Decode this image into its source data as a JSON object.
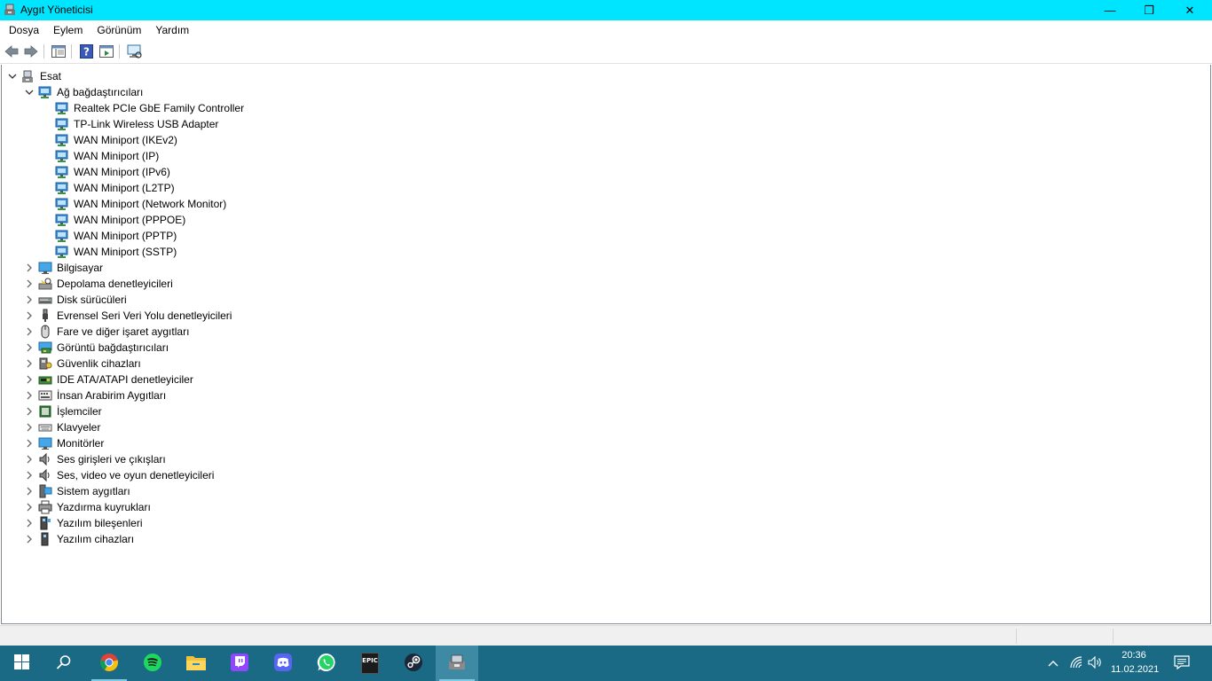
{
  "window": {
    "title": "Aygıt Yöneticisi",
    "icon": "device-manager-icon",
    "controls": {
      "minimize": "—",
      "maximize": "❐",
      "close": "✕"
    }
  },
  "menu": [
    "Dosya",
    "Eylem",
    "Görünüm",
    "Yardım"
  ],
  "toolbar": {
    "buttons": [
      "back-arrow-icon",
      "forward-arrow-icon",
      "show-hide-tree-icon",
      "help-icon",
      "properties-icon",
      "scan-hardware-icon"
    ]
  },
  "tree": {
    "root": "Esat",
    "expanded_category": "Ağ bağdaştırıcıları",
    "network_adapters": [
      "Realtek PCIe GbE Family Controller",
      "TP-Link Wireless USB Adapter",
      "WAN Miniport (IKEv2)",
      "WAN Miniport (IP)",
      "WAN Miniport (IPv6)",
      "WAN Miniport (L2TP)",
      "WAN Miniport (Network Monitor)",
      "WAN Miniport (PPPOE)",
      "WAN Miniport (PPTP)",
      "WAN Miniport (SSTP)"
    ],
    "categories": [
      "Bilgisayar",
      "Depolama denetleyicileri",
      "Disk sürücüleri",
      "Evrensel Seri Veri Yolu denetleyicileri",
      "Fare ve diğer işaret aygıtları",
      "Görüntü bağdaştırıcıları",
      "Güvenlik cihazları",
      "IDE ATA/ATAPI denetleyiciler",
      "İnsan Arabirim Aygıtları",
      "İşlemciler",
      "Klavyeler",
      "Monitörler",
      "Ses girişleri ve çıkışları",
      "Ses, video ve oyun denetleyicileri",
      "Sistem aygıtları",
      "Yazdırma kuyrukları",
      "Yazılım bileşenleri",
      "Yazılım cihazları"
    ]
  },
  "taskbar": {
    "apps": [
      "start-icon",
      "search-icon",
      "chrome-icon",
      "spotify-icon",
      "file-explorer-icon",
      "twitch-icon",
      "discord-icon",
      "whatsapp-icon",
      "epic-games-icon",
      "steam-icon",
      "device-manager-icon"
    ],
    "epic_text": "EPIC",
    "time": "20:36",
    "date": "11.02.2021"
  },
  "colors": {
    "titlebar": "#00e5ff",
    "taskbar": "#1a6a86",
    "accent": "#7fc9e5"
  }
}
